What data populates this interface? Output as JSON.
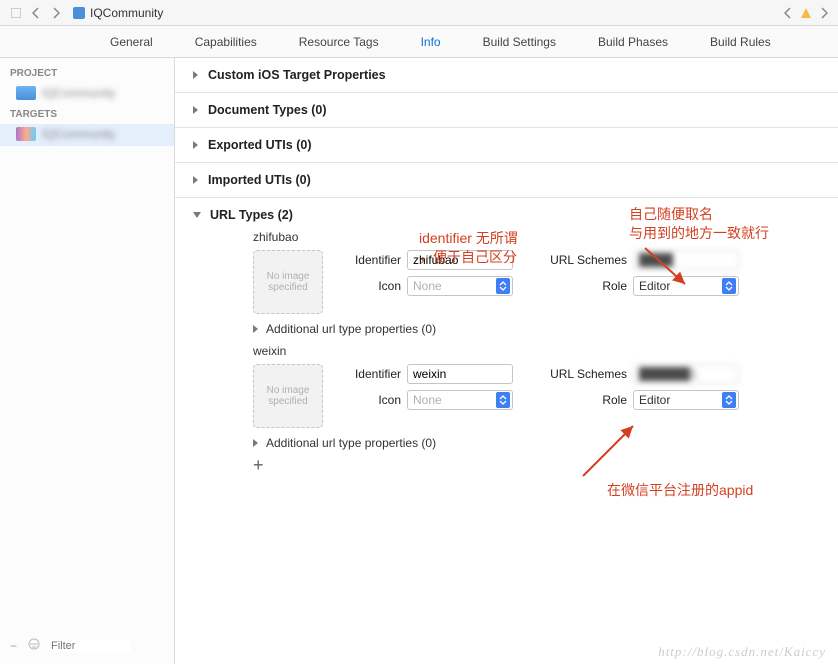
{
  "topbar": {
    "title": "IQCommunity"
  },
  "tabs": [
    "General",
    "Capabilities",
    "Resource Tags",
    "Info",
    "Build Settings",
    "Build Phases",
    "Build Rules"
  ],
  "active_tab": "Info",
  "sidebar": {
    "project_header": "PROJECT",
    "project_name": "IQCommunity",
    "targets_header": "TARGETS",
    "target_name": "IQCommunity",
    "filter_placeholder": "Filter"
  },
  "sections": [
    {
      "label": "Custom iOS Target Properties",
      "open": false
    },
    {
      "label": "Document Types (0)",
      "open": false
    },
    {
      "label": "Exported UTIs (0)",
      "open": false
    },
    {
      "label": "Imported UTIs (0)",
      "open": false
    },
    {
      "label": "URL Types (2)",
      "open": true
    }
  ],
  "url_types": [
    {
      "name": "zhifubao",
      "thumb": "No image specified",
      "identifier_label": "Identifier",
      "identifier_value": "zhifubao",
      "icon_label": "Icon",
      "icon_value": "None",
      "schemes_label": "URL Schemes",
      "schemes_value": "████",
      "role_label": "Role",
      "role_value": "Editor",
      "additional": "Additional url type properties (0)"
    },
    {
      "name": "weixin",
      "thumb": "No image specified",
      "identifier_label": "Identifier",
      "identifier_value": "weixin",
      "icon_label": "Icon",
      "icon_value": "None",
      "schemes_label": "URL Schemes",
      "schemes_value": "██████1",
      "role_label": "Role",
      "role_value": "Editor",
      "additional": "Additional url type properties (0)"
    }
  ],
  "annotations": {
    "a1": "自己随便取名\n与用到的地方一致就行",
    "a2": "identifier 无所谓\n，便于自己区分",
    "a3": "在微信平台注册的appid"
  },
  "watermark": "http://blog.csdn.net/Kaiccy"
}
